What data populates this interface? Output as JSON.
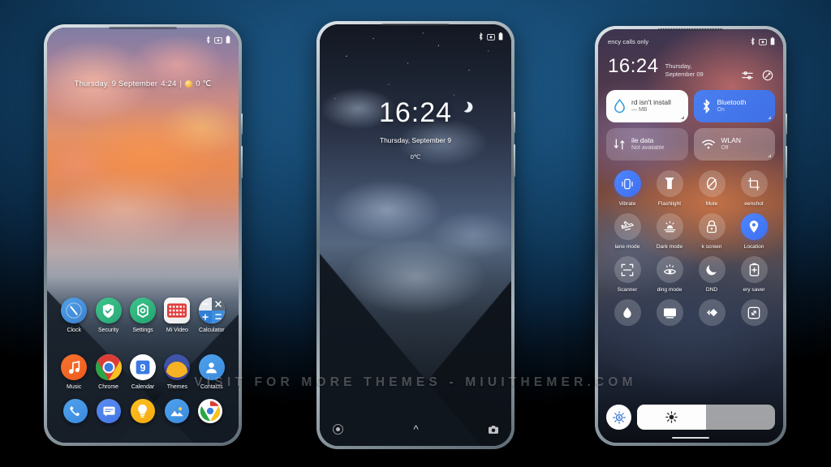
{
  "background": {
    "accent": "#1a5080",
    "bottom": "#000000"
  },
  "watermark": {
    "text": "VISIT FOR MORE THEMES - MIUITHEMER.COM"
  },
  "phone1": {
    "name": "home-screen",
    "statusbar": {
      "carrier": "",
      "icons": [
        "bluetooth-icon",
        "screenshot-icon",
        "battery-icon"
      ]
    },
    "widget": {
      "date": "Thursday. 9 September",
      "time": "4:24",
      "separator": "|",
      "weather_icon": "sun-icon",
      "temperature": "0 ℃"
    },
    "apps": [
      {
        "label": "Clock",
        "icon": "clock-icon"
      },
      {
        "label": "Security",
        "icon": "shield-icon"
      },
      {
        "label": "Settings",
        "icon": "gear-icon"
      },
      {
        "label": "Mi Video",
        "icon": "video-icon"
      },
      {
        "label": "Calculator",
        "icon": "calculator-icon"
      },
      {
        "label": "Music",
        "icon": "music-note-icon"
      },
      {
        "label": "Chrome",
        "icon": "chrome-icon"
      },
      {
        "label": "Calendar",
        "icon": "calendar-icon"
      },
      {
        "label": "Themes",
        "icon": "themes-icon"
      },
      {
        "label": "Contacts",
        "icon": "person-icon"
      }
    ],
    "calendar_day": "9",
    "dock": [
      {
        "label": "Phone",
        "icon": "phone-icon"
      },
      {
        "label": "Messages",
        "icon": "message-icon"
      },
      {
        "label": "Torch",
        "icon": "lightbulb-icon"
      },
      {
        "label": "Gallery",
        "icon": "gallery-icon"
      },
      {
        "label": "Browser",
        "icon": "browser-icon"
      }
    ]
  },
  "phone2": {
    "name": "lock-screen",
    "statusbar": {
      "carrier": "",
      "icons": [
        "bluetooth-icon",
        "screenshot-icon",
        "battery-icon"
      ]
    },
    "clock": {
      "time": "16:24",
      "date": "Thursday, September 9",
      "temperature": "0℃",
      "moon_icon": "crescent-moon-icon"
    },
    "bottom": {
      "left_icon": "torch-shortcut-icon",
      "center_icon": "unlock-chevron-icon",
      "right_icon": "camera-icon"
    }
  },
  "phone3": {
    "name": "control-center",
    "statusbar": {
      "carrier": "ency calls only",
      "icons": [
        "bluetooth-icon",
        "screenshot-icon",
        "battery-icon"
      ]
    },
    "header": {
      "time": "16:24",
      "date": "Thursday, September 09",
      "actions": [
        {
          "name": "settings-sliders-icon"
        },
        {
          "name": "edit-toggles-icon"
        }
      ]
    },
    "big_tiles": [
      {
        "title": "rd isn't install",
        "subtitle": "— MB",
        "icon": "storage-droplet-icon",
        "state": "white"
      },
      {
        "title": "Bluetooth",
        "subtitle": "On",
        "icon": "bluetooth-icon",
        "state": "blue"
      },
      {
        "title": "ile data",
        "subtitle": "Not available",
        "icon": "mobile-data-icon",
        "state": "dim"
      },
      {
        "title": "WLAN",
        "subtitle": "Off",
        "icon": "wifi-icon",
        "state": "warm"
      }
    ],
    "toggles": [
      {
        "label": "Vibrate",
        "icon": "vibrate-icon",
        "on": true
      },
      {
        "label": "Flashlight",
        "icon": "flashlight-icon",
        "on": false
      },
      {
        "label": "Mute",
        "icon": "mute-icon",
        "on": false
      },
      {
        "label": "eenshot",
        "icon": "screenshot-icon",
        "on": false
      },
      {
        "label": "lane mode",
        "icon": "airplane-icon",
        "on": false
      },
      {
        "label": "Dark mode",
        "icon": "dark-mode-icon",
        "on": false
      },
      {
        "label": "k screen",
        "icon": "lock-screen-icon",
        "on": false
      },
      {
        "label": "Location",
        "icon": "location-pin-icon",
        "on": true
      },
      {
        "label": "Scanner",
        "icon": "scanner-icon",
        "on": false
      },
      {
        "label": "ding mode",
        "icon": "reading-mode-icon",
        "on": false
      },
      {
        "label": "DND",
        "icon": "do-not-disturb-moon-icon",
        "on": false
      },
      {
        "label": "ery saver",
        "icon": "battery-saver-icon",
        "on": false
      },
      {
        "label": "",
        "icon": "sync-droplet-icon",
        "on": false
      },
      {
        "label": "",
        "icon": "cast-screen-icon",
        "on": false
      },
      {
        "label": "",
        "icon": "color-invert-icon",
        "on": false
      },
      {
        "label": "",
        "icon": "screen-rotation-icon",
        "on": false
      }
    ],
    "brightness": {
      "auto_icon": "auto-brightness-icon",
      "slider_icon": "sun-brightness-icon",
      "value": 50
    }
  }
}
